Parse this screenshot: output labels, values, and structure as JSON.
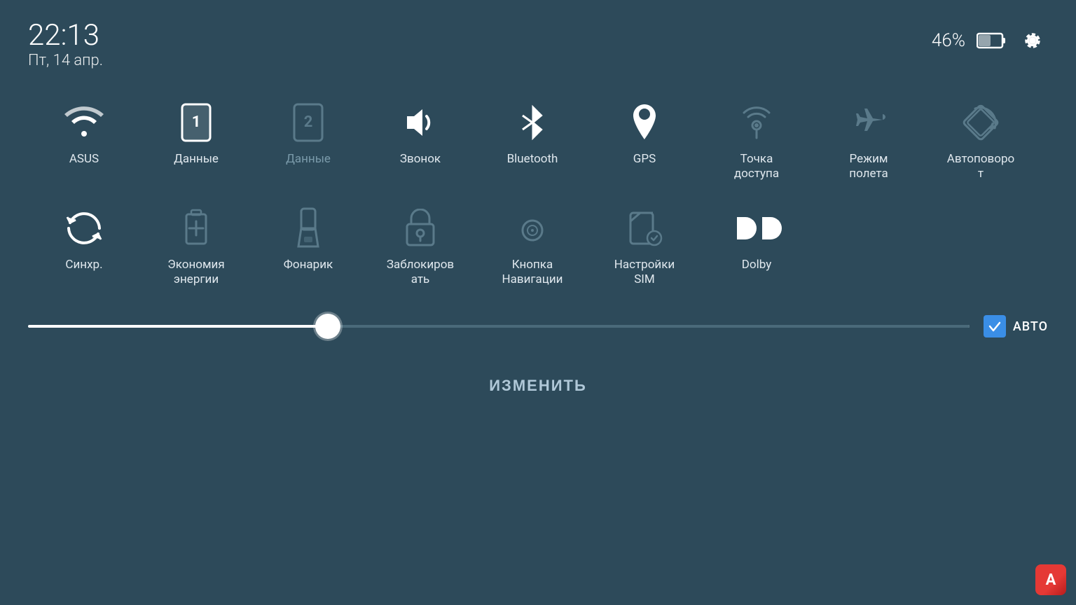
{
  "header": {
    "time": "22:13",
    "date": "Пт, 14 апр.",
    "battery_pct": "46%",
    "settings_label": "Settings"
  },
  "row1_tiles": [
    {
      "id": "wifi",
      "label": "ASUS",
      "active": true,
      "icon": "wifi"
    },
    {
      "id": "data1",
      "label": "Данные",
      "active": true,
      "icon": "sim1"
    },
    {
      "id": "data2",
      "label": "Данные",
      "active": false,
      "icon": "sim2"
    },
    {
      "id": "sound",
      "label": "Звонок",
      "active": true,
      "icon": "sound"
    },
    {
      "id": "bluetooth",
      "label": "Bluetooth",
      "active": true,
      "icon": "bluetooth"
    },
    {
      "id": "gps",
      "label": "GPS",
      "active": true,
      "icon": "gps"
    },
    {
      "id": "hotspot",
      "label": "Точка доступа",
      "active": false,
      "icon": "hotspot"
    },
    {
      "id": "airplane",
      "label": "Режим полета",
      "active": false,
      "icon": "airplane"
    },
    {
      "id": "autorotate",
      "label": "Автоповорот",
      "active": false,
      "icon": "autorotate"
    }
  ],
  "row2_tiles": [
    {
      "id": "sync",
      "label": "Синхр.",
      "active": true,
      "icon": "sync"
    },
    {
      "id": "battery_saver",
      "label": "Экономия энергии",
      "active": false,
      "icon": "battery_saver"
    },
    {
      "id": "flashlight",
      "label": "Фонарик",
      "active": false,
      "icon": "flashlight"
    },
    {
      "id": "lockscreen",
      "label": "Заблокировать",
      "active": false,
      "icon": "lock"
    },
    {
      "id": "nav_button",
      "label": "Кнопка Навигации",
      "active": false,
      "icon": "nav"
    },
    {
      "id": "sim_settings",
      "label": "Настройки SIM",
      "active": false,
      "icon": "sim_settings"
    },
    {
      "id": "dolby",
      "label": "Dolby",
      "active": true,
      "icon": "dolby"
    }
  ],
  "brightness": {
    "value": 27,
    "auto_label": "АВТО",
    "auto_checked": true
  },
  "change_btn": {
    "label": "ИЗМЕНИТЬ"
  },
  "bottom_app": {
    "label": "A"
  }
}
